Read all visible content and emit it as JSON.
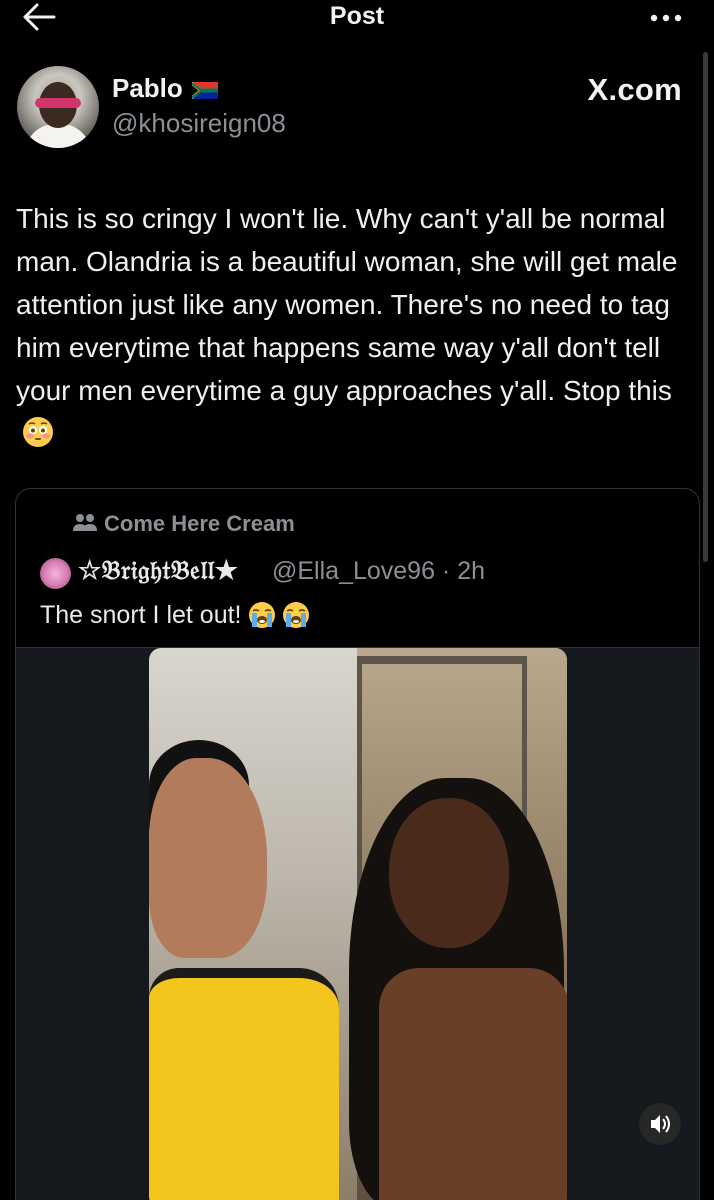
{
  "header": {
    "title": "Post"
  },
  "post": {
    "author_name": "Pablo",
    "author_handle": "@khosireign08",
    "watermark": "X.com",
    "text": "This is so cringy I won't lie. Why can't y'all be normal man. Olandria is a beautiful woman, she will get male attention just like any women. There's no need to tag him everytime that happens same way y'all don't tell your men everytime a guy approaches y'all. Stop this"
  },
  "quote": {
    "community": "Come Here Cream",
    "author_name": "☆𝔅𝔯𝔦𝔤𝔥𝔱𝔅𝔢𝔩𝔩★",
    "author_handle": "@Ella_Love96 · 2h",
    "text": "The snort I let out!"
  },
  "icons": {
    "back": "back-arrow-icon",
    "more": "more-options-icon",
    "flag": "south-africa-flag-icon",
    "community": "community-icon",
    "emoji_flushed": "flushed-face-emoji",
    "emoji_cry": "loudly-crying-face-emoji",
    "mute": "volume-icon"
  },
  "colors": {
    "background": "#000000",
    "text_primary": "#e7e9ea",
    "text_secondary": "#8b9096",
    "border": "#2f3336"
  }
}
